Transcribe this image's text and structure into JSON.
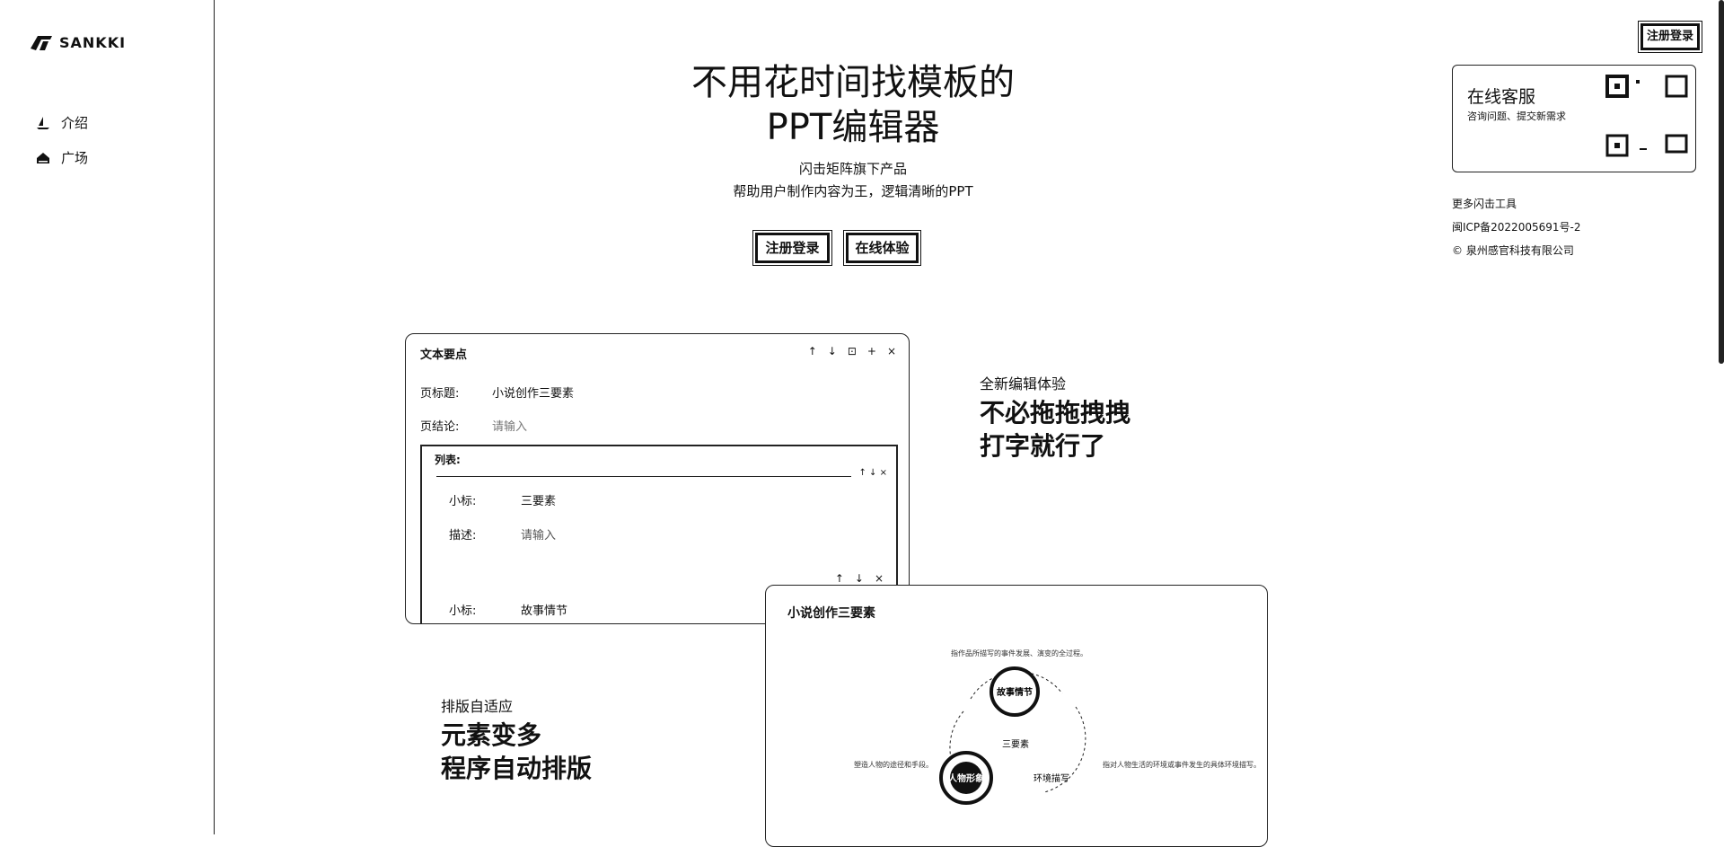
{
  "brand": {
    "name": "SANKKI"
  },
  "sidebar": {
    "items": [
      {
        "label": "介绍",
        "icon": "sailboat-icon"
      },
      {
        "label": "广场",
        "icon": "home-icon"
      }
    ]
  },
  "header": {
    "login_button": "注册登录"
  },
  "hero": {
    "title_line1": "不用花时间找模板的",
    "title_line2": "PPT编辑器",
    "subtitle_line1": "闪击矩阵旗下产品",
    "subtitle_line2": "帮助用户制作内容为王，逻辑清晰的PPT",
    "register_button": "注册登录",
    "try_button": "在线体验"
  },
  "editor_card": {
    "title": "文本要点",
    "tools": [
      "↑",
      "↓",
      "⊡",
      "+",
      "×"
    ],
    "page_title_label": "页标题:",
    "page_title_value": "小说创作三要素",
    "page_conclusion_label": "页结论:",
    "page_conclusion_placeholder": "请输入",
    "list_label": "列表:",
    "list_tools": "↑ ↓ ×",
    "items": [
      {
        "sub_label": "小标:",
        "sub_value": "三要素",
        "desc_label": "描述:",
        "desc_value": "请输入"
      },
      {
        "sub_label": "小标:",
        "sub_value": "故事情节"
      }
    ]
  },
  "feature1": {
    "small": "全新编辑体验",
    "big_line1": "不必拖拖拽拽",
    "big_line2": "打字就行了"
  },
  "feature2": {
    "small": "排版自适应",
    "big_line1": "元素变多",
    "big_line2": "程序自动排版"
  },
  "preview_card": {
    "title": "小说创作三要素",
    "center": "三要素",
    "node1": "故事情节",
    "node1_desc": "指作品所描写的事件发展、演变的全过程。",
    "node2": "人物形象",
    "node2_desc": "塑造人物的途径和手段。",
    "node3": "环境描写",
    "node3_desc": "指对人物生活的环境或事件发生的具体环境描写。"
  },
  "service": {
    "title": "在线客服",
    "desc": "咨询问题、提交新需求"
  },
  "footer": {
    "more_tools": "更多闪击工具",
    "icp": "闽ICP备2022005691号-2",
    "copyright": "© 泉州感官科技有限公司"
  }
}
